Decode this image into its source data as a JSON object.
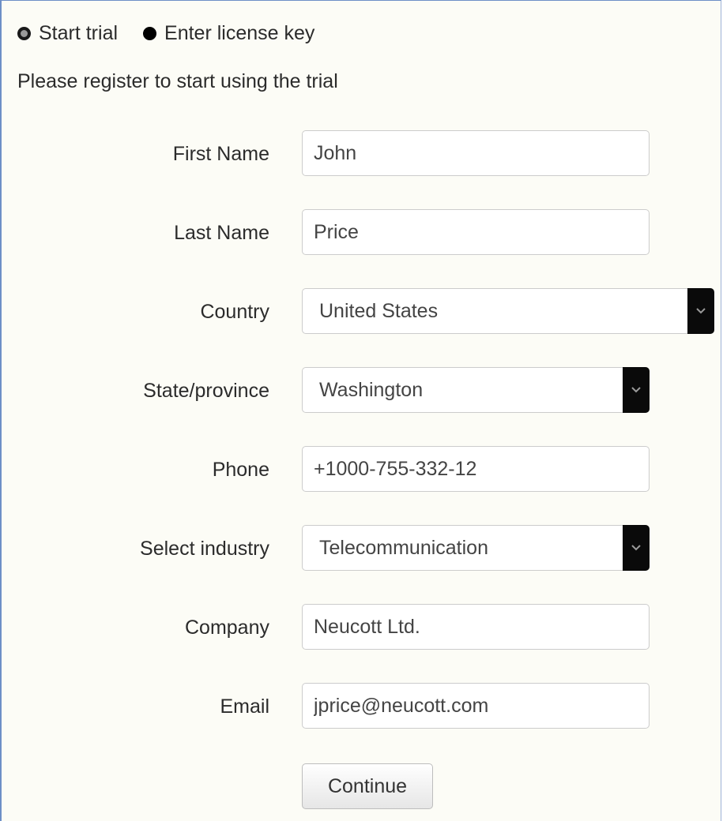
{
  "mode_options": [
    {
      "label": "Start trial",
      "selected": true
    },
    {
      "label": "Enter license key",
      "selected": false
    }
  ],
  "intro_text": "Please register to start using the trial",
  "fields": {
    "first_name": {
      "label": "First Name",
      "value": "John"
    },
    "last_name": {
      "label": "Last Name",
      "value": "Price"
    },
    "country": {
      "label": "Country",
      "value": "United States"
    },
    "state": {
      "label": "State/province",
      "value": "Washington"
    },
    "phone": {
      "label": "Phone",
      "value": "+1000-755-332-12"
    },
    "industry": {
      "label": "Select industry",
      "value": "Telecommunication"
    },
    "company": {
      "label": "Company",
      "value": "Neucott Ltd."
    },
    "email": {
      "label": "Email",
      "value": "jprice@neucott.com"
    }
  },
  "continue_label": "Continue",
  "icons": {
    "select_arrow": "chevron-down-icon"
  },
  "colors": {
    "panel_background": "#fcfcf6",
    "panel_border": "#6d8fc7",
    "select_arrow_background": "#0a0a0a"
  }
}
